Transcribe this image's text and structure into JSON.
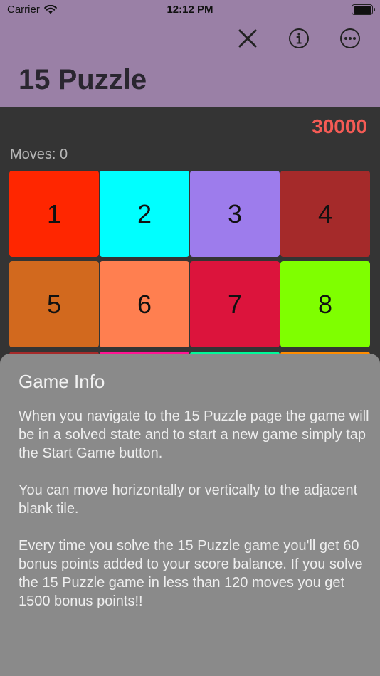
{
  "status": {
    "carrier": "Carrier",
    "time": "12:12 PM"
  },
  "header": {
    "title": "15 Puzzle",
    "icons": [
      "close-icon",
      "info-icon",
      "more-icon"
    ]
  },
  "game": {
    "score": "30000",
    "moves_label": "Moves: 0",
    "tiles": [
      {
        "number": "1",
        "color": "#ff2600"
      },
      {
        "number": "2",
        "color": "#00ffff"
      },
      {
        "number": "3",
        "color": "#9d7cec"
      },
      {
        "number": "4",
        "color": "#a52a2a"
      },
      {
        "number": "5",
        "color": "#d2691e"
      },
      {
        "number": "6",
        "color": "#ff7f50"
      },
      {
        "number": "7",
        "color": "#dc143c"
      },
      {
        "number": "8",
        "color": "#7fff00"
      },
      {
        "number": "",
        "color": "#a52a2a"
      },
      {
        "number": "",
        "color": "#ff1493"
      },
      {
        "number": "",
        "color": "#00fa9a"
      },
      {
        "number": "",
        "color": "#ff8c00"
      }
    ]
  },
  "info_sheet": {
    "title": "Game Info",
    "paragraphs": [
      "When you navigate to the 15 Puzzle page the game will be in a solved state and to start a new game simply tap the Start Game button.",
      "You can move horizontally or vertically to the adjacent blank tile.",
      "Every time you solve the 15 Puzzle game you'll get 60 bonus points added to your score balance. If you solve the 15 Puzzle game in less than 120 moves you get 1500 bonus points!!"
    ]
  }
}
